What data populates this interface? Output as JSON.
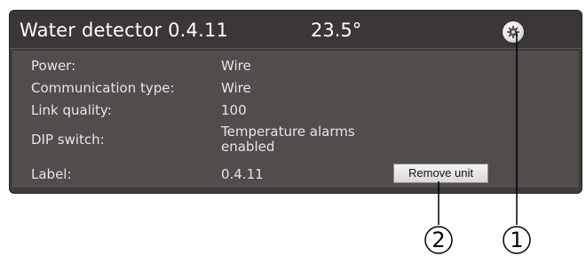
{
  "device": {
    "title": "Water detector 0.4.11",
    "temperature": "23.5°",
    "settings_icon": "gear-icon"
  },
  "details": {
    "power_label": "Power:",
    "power_value": "Wire",
    "comm_label": "Communication type:",
    "comm_value": "Wire",
    "link_label": "Link quality:",
    "link_value": "100",
    "dip_label": "DIP switch:",
    "dip_value_line1": "Temperature alarms",
    "dip_value_line2": "enabled",
    "label_label": "Label:",
    "label_value": "0.4.11"
  },
  "actions": {
    "remove_label": "Remove unit"
  },
  "callouts": {
    "one": "1",
    "two": "2"
  },
  "colors": {
    "panel": "#3e3b3a",
    "panel_body": "#514d4b",
    "text": "#ffffff"
  }
}
